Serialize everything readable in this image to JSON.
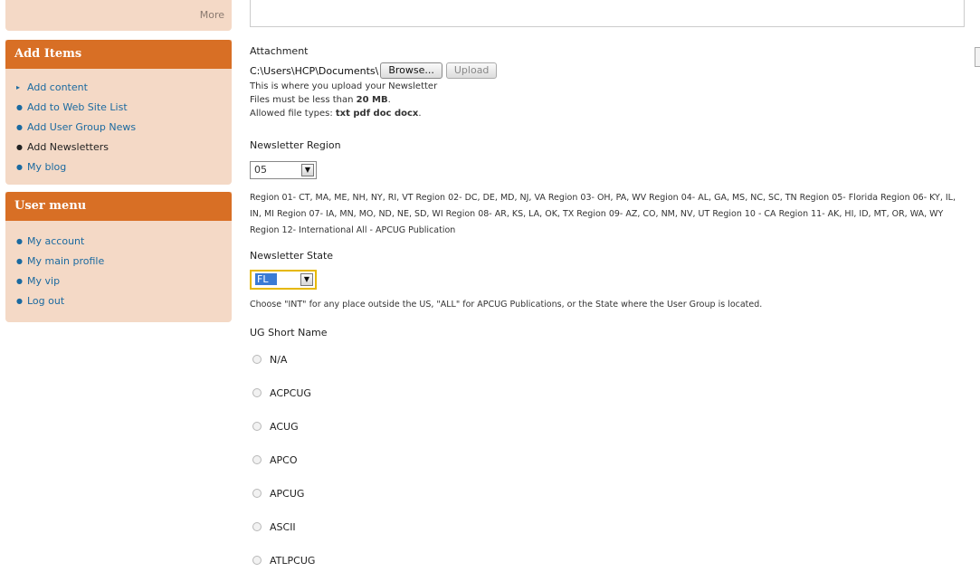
{
  "sidebar": {
    "top_block": {
      "more_label": "More"
    },
    "add_items": {
      "title": "Add Items",
      "items": [
        {
          "label": "Add content",
          "bullet": "▸"
        },
        {
          "label": "Add to Web Site List",
          "bullet": "●"
        },
        {
          "label": "Add User Group News",
          "bullet": "●"
        },
        {
          "label": "Add Newsletters",
          "bullet": "●"
        },
        {
          "label": "My blog",
          "bullet": "●"
        }
      ]
    },
    "user_menu": {
      "title": "User menu",
      "items": [
        {
          "label": "My account",
          "bullet": "●"
        },
        {
          "label": "My main profile",
          "bullet": "●"
        },
        {
          "label": "My vip",
          "bullet": "●"
        },
        {
          "label": "Log out",
          "bullet": "●"
        }
      ]
    }
  },
  "form": {
    "attachment": {
      "label": "Attachment",
      "file_path": "C:\\Users\\HCP\\Documents\\",
      "browse_label": "Browse...",
      "upload_label": "Upload",
      "help_1": "This is where you upload your Newsletter",
      "help_2_prefix": "Files must be less than ",
      "help_2_size": "20 MB",
      "help_2_suffix": ".",
      "help_3_prefix": "Allowed file types: ",
      "help_3_types": "txt pdf doc docx",
      "help_3_suffix": "."
    },
    "region": {
      "label": "Newsletter Region",
      "value": "05",
      "help": "Region 01- CT, MA, ME, NH, NY, RI, VT Region 02- DC, DE, MD, NJ, VA Region 03- OH, PA, WV Region 04- AL, GA, MS, NC, SC, TN Region 05- Florida Region 06- KY, IL, IN, MI Region 07- IA, MN, MO, ND, NE, SD, WI Region 08- AR, KS, LA, OK, TX Region 09- AZ, CO, NM, NV, UT Region 10 - CA Region 11- AK, HI, ID, MT, OR, WA, WY Region 12- International All - APCUG Publication"
    },
    "state": {
      "label": "Newsletter State",
      "value": "FL",
      "help": "Choose \"INT\" for any place outside the US, \"ALL\" for APCUG Publications, or the State where the User Group is located."
    },
    "ug_short_name": {
      "label": "UG Short Name",
      "options": [
        "N/A",
        "ACPCUG",
        "ACUG",
        "APCO",
        "APCUG",
        "ASCII",
        "ATLPCUG"
      ]
    }
  },
  "icons": {
    "select_arrow": "chevron-down-icon",
    "radio": "radio-icon"
  }
}
